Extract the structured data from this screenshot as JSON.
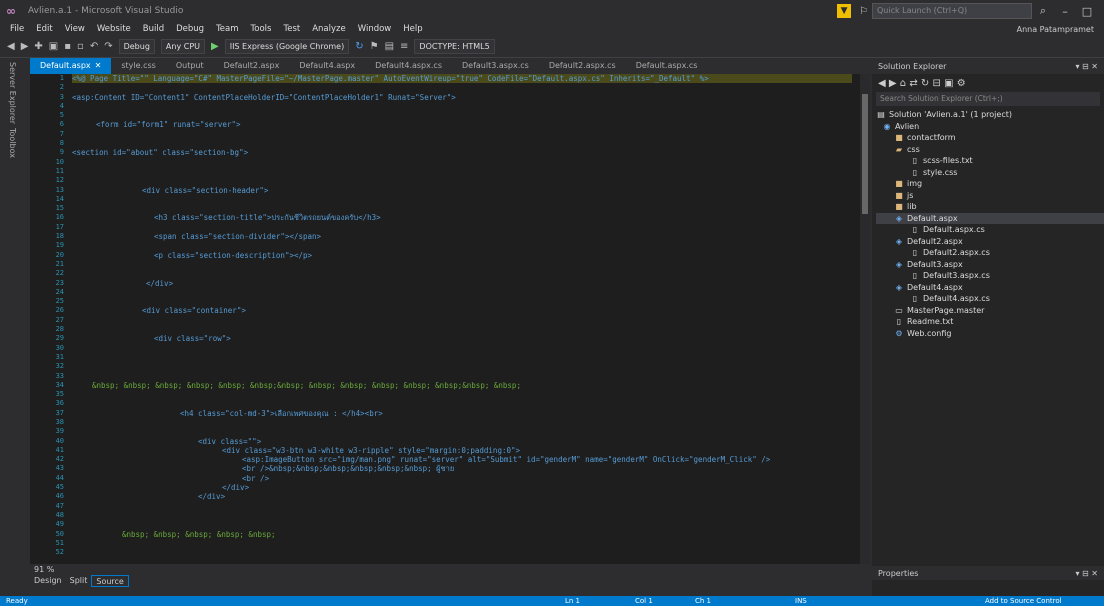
{
  "titlebar": {
    "app_title": "Avlien.a.1 - Microsoft Visual Studio",
    "quick_launch": "Quick Launch (Ctrl+Q)",
    "user": "Anna Patampramet"
  },
  "menu": [
    "File",
    "Edit",
    "View",
    "Website",
    "Build",
    "Debug",
    "Team",
    "Tools",
    "Test",
    "Analyze",
    "Window",
    "Help"
  ],
  "toolbar": {
    "config": "Debug",
    "platform": "Any CPU",
    "run": "IIS Express (Google Chrome)",
    "doctype": "DOCTYPE: HTML5"
  },
  "tabs": [
    "Default.aspx",
    "style.css",
    "Output",
    "Default2.aspx",
    "Default4.aspx",
    "Default4.aspx.cs",
    "Default3.aspx.cs",
    "Default2.aspx.cs",
    "Default.aspx.cs"
  ],
  "code": {
    "line_numbers": [
      "1",
      "2",
      "3",
      "4",
      "5",
      "6",
      "7",
      "8",
      "9",
      "10",
      "11",
      "12",
      "13",
      "14",
      "15",
      "16",
      "17",
      "18",
      "19",
      "20",
      "21",
      "22",
      "23",
      "24",
      "25",
      "26",
      "27",
      "28",
      "29",
      "30",
      "31",
      "32",
      "33",
      "34",
      "35",
      "36",
      "37",
      "38",
      "39",
      "40",
      "41",
      "42",
      "43",
      "44",
      "45",
      "46",
      "47",
      "48",
      "49",
      "50",
      "51",
      "52"
    ],
    "l1": "<%@ Page Title=\"\" Language=\"C#\" MasterPageFile=\"~/MasterPage.master\" AutoEventWireup=\"true\" CodeFile=\"Default.aspx.cs\" Inherits=\"_Default\" %>",
    "l3": "<asp:Content ID=\"Content1\" ContentPlaceHolderID=\"ContentPlaceHolder1\" Runat=\"Server\">",
    "l6": "<form id=\"form1\" runat=\"server\">",
    "l9": "<section id=\"about\" class=\"section-bg\">",
    "l13": "<div class=\"section-header\">",
    "l16": "<h3 class=\"section-title\">ประกันชีวิตรถยนต์ของครับ</h3>",
    "l18": "<span class=\"section-divider\"></span>",
    "l20": "<p class=\"section-description\"></p>",
    "l23": "</div>",
    "l26": "<div class=\"container\">",
    "l29": "<div class=\"row\">",
    "l34": "&nbsp; &nbsp; &nbsp; &nbsp; &nbsp; &nbsp;&nbsp; &nbsp; &nbsp; &nbsp; &nbsp; &nbsp;&nbsp; &nbsp;",
    "l37": "<h4 class=\"col-md-3\">เลือกเพศของคุณ : </h4><br>",
    "l40": "<div class=\"\">",
    "l41": "<div class=\"w3-btn w3-white w3-ripple\" style=\"margin:0;padding:0\">",
    "l42": "<asp:ImageButton src=\"img/man.png\" runat=\"server\" alt=\"Submit\" id=\"genderM\" name=\"genderM\" OnClick=\"genderM_Click\" />",
    "l43": "<br />&nbsp;&nbsp;&nbsp;&nbsp;&nbsp;&nbsp; ผู้ชาย",
    "l44": "<br />",
    "l45": "</div>",
    "l46": "</div>",
    "l50": "&nbsp; &nbsp; &nbsp; &nbsp; &nbsp;"
  },
  "editor": {
    "zoom": "91 %"
  },
  "views": [
    "Design",
    "Split",
    "Source"
  ],
  "solution": {
    "header": "Solution Explorer",
    "search": "Search Solution Explorer (Ctrl+;)",
    "items": [
      "Solution 'Avlien.a.1' (1 project)",
      "Avlien",
      "contactform",
      "css",
      "scss-files.txt",
      "style.css",
      "img",
      "js",
      "lib",
      "Default.aspx",
      "Default.aspx.cs",
      "Default2.aspx",
      "Default2.aspx.cs",
      "Default3.aspx",
      "Default3.aspx.cs",
      "Default4.aspx",
      "Default4.aspx.cs",
      "MasterPage.master",
      "Readme.txt",
      "Web.config"
    ]
  },
  "properties": "Properties",
  "status": {
    "ready": "Ready",
    "ln": "Ln 1",
    "col": "Col 1",
    "ch": "Ch 1",
    "ins": "INS",
    "source_control": "Add to Source Control"
  }
}
